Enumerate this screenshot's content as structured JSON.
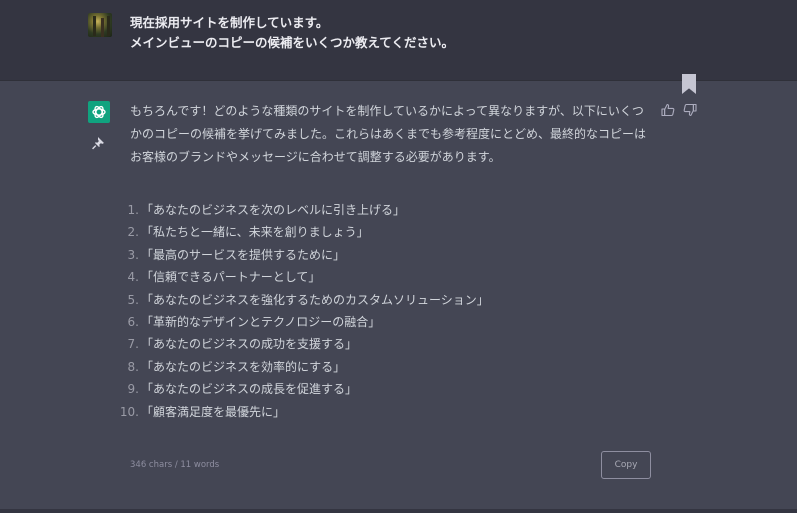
{
  "user_message": {
    "lines": [
      "現在採用サイトを制作しています。",
      "メインビューのコピーの候補をいくつか教えてください。"
    ]
  },
  "assistant_message": {
    "intro": "もちろんです！どのような種類のサイトを制作しているかによって異なりますが、以下にいくつかのコピーの候補を挙げてみました。これらはあくまでも参考程度にとどめ、最終的なコピーはお客様のブランドやメッセージに合わせて調整する必要があります。",
    "items": [
      {
        "num": "1.",
        "text": "「あなたのビジネスを次のレベルに引き上げる」"
      },
      {
        "num": "2.",
        "text": "「私たちと一緒に、未来を創りましょう」"
      },
      {
        "num": "3.",
        "text": "「最高のサービスを提供するために」"
      },
      {
        "num": "4.",
        "text": "「信頼できるパートナーとして」"
      },
      {
        "num": "5.",
        "text": "「あなたのビジネスを強化するためのカスタムソリューション」"
      },
      {
        "num": "6.",
        "text": "「革新的なデザインとテクノロジーの融合」"
      },
      {
        "num": "7.",
        "text": "「あなたのビジネスの成功を支援する」"
      },
      {
        "num": "8.",
        "text": "「あなたのビジネスを効率的にする」"
      },
      {
        "num": "9.",
        "text": "「あなたのビジネスの成長を促進する」"
      },
      {
        "num": "10.",
        "text": "「顧客満足度を最優先に」"
      }
    ],
    "word_count": "346 chars / 11 words",
    "copy_label": "Copy"
  },
  "icons": {
    "user_avatar": "user-avatar-photo",
    "assistant_avatar": "openai-logo-icon",
    "pin": "pin-icon",
    "bookmark": "bookmark-icon",
    "thumbs_up": "thumbs-up-icon",
    "thumbs_down": "thumbs-down-icon"
  },
  "colors": {
    "user_bg": "#343541",
    "assistant_bg": "#444654",
    "brand_green": "#10a37f",
    "text": "#d1d5db"
  }
}
